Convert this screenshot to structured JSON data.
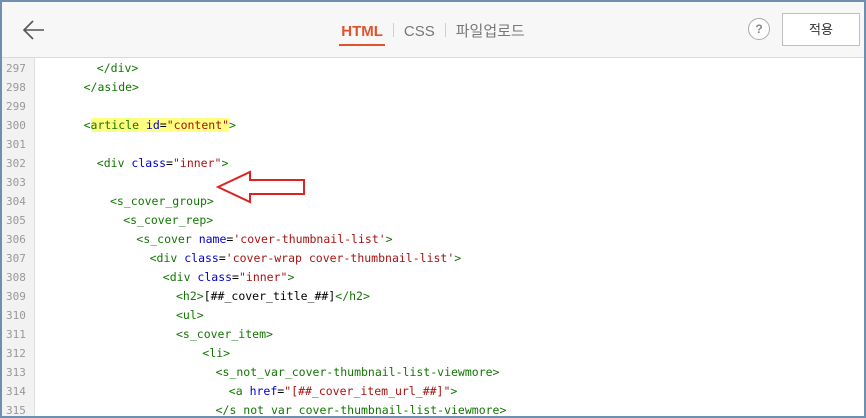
{
  "header": {
    "tabs": [
      {
        "label": "HTML",
        "active": true
      },
      {
        "label": "CSS",
        "active": false
      },
      {
        "label": "파일업로드",
        "active": false
      }
    ],
    "help_label": "?",
    "apply_label": "적용",
    "accent_color": "#e0532d"
  },
  "editor": {
    "lines": [
      {
        "n": "297",
        "indent": 8,
        "tokens": [
          [
            "tag",
            "</div>"
          ]
        ]
      },
      {
        "n": "298",
        "indent": 6,
        "tokens": [
          [
            "tag",
            "</aside>"
          ]
        ]
      },
      {
        "n": "299",
        "indent": 0,
        "tokens": []
      },
      {
        "n": "300",
        "indent": 6,
        "tokens": [
          [
            "tag",
            "<"
          ],
          [
            "tag hl",
            "article"
          ],
          [
            "txt hl",
            " "
          ],
          [
            "attr hl",
            "id"
          ],
          [
            "txt hl",
            "="
          ],
          [
            "str hl",
            "\"content\""
          ],
          [
            "tag",
            ">"
          ]
        ]
      },
      {
        "n": "301",
        "indent": 0,
        "tokens": []
      },
      {
        "n": "302",
        "indent": 8,
        "tokens": [
          [
            "tag",
            "<div "
          ],
          [
            "attr",
            "class"
          ],
          [
            "txt",
            "="
          ],
          [
            "str",
            "\"inner\""
          ],
          [
            "tag",
            ">"
          ]
        ]
      },
      {
        "n": "303",
        "indent": 0,
        "tokens": []
      },
      {
        "n": "304",
        "indent": 10,
        "tokens": [
          [
            "tag",
            "<s_cover_group>"
          ]
        ]
      },
      {
        "n": "305",
        "indent": 12,
        "tokens": [
          [
            "tag",
            "<s_cover_rep>"
          ]
        ]
      },
      {
        "n": "306",
        "indent": 14,
        "tokens": [
          [
            "tag",
            "<s_cover "
          ],
          [
            "attr",
            "name"
          ],
          [
            "txt",
            "="
          ],
          [
            "str",
            "'cover-thumbnail-list'"
          ],
          [
            "tag",
            ">"
          ]
        ]
      },
      {
        "n": "307",
        "indent": 16,
        "tokens": [
          [
            "tag",
            "<div "
          ],
          [
            "attr",
            "class"
          ],
          [
            "txt",
            "="
          ],
          [
            "str",
            "'cover-wrap cover-thumbnail-list'"
          ],
          [
            "tag",
            ">"
          ]
        ]
      },
      {
        "n": "308",
        "indent": 18,
        "tokens": [
          [
            "tag",
            "<div "
          ],
          [
            "attr",
            "class"
          ],
          [
            "txt",
            "="
          ],
          [
            "str",
            "\"inner\""
          ],
          [
            "tag",
            ">"
          ]
        ]
      },
      {
        "n": "309",
        "indent": 20,
        "tokens": [
          [
            "tag",
            "<h2>"
          ],
          [
            "txt",
            "[##_cover_title_##]"
          ],
          [
            "tag",
            "</h2>"
          ]
        ]
      },
      {
        "n": "310",
        "indent": 20,
        "tokens": [
          [
            "tag",
            "<ul>"
          ]
        ]
      },
      {
        "n": "311",
        "indent": 20,
        "tokens": [
          [
            "tag",
            "<s_cover_item>"
          ]
        ]
      },
      {
        "n": "312",
        "indent": 24,
        "tokens": [
          [
            "tag",
            "<li>"
          ]
        ]
      },
      {
        "n": "313",
        "indent": 26,
        "tokens": [
          [
            "tag",
            "<s_not_var_cover-thumbnail-list-viewmore>"
          ]
        ]
      },
      {
        "n": "314",
        "indent": 28,
        "tokens": [
          [
            "tag",
            "<a "
          ],
          [
            "attr",
            "href"
          ],
          [
            "txt",
            "="
          ],
          [
            "str",
            "\"[##_cover_item_url_##]\""
          ],
          [
            "tag",
            ">"
          ]
        ]
      },
      {
        "n": "315",
        "indent": 26,
        "tokens": [
          [
            "tag",
            "</s_not_var_cover-thumbnail-list-viewmore>"
          ]
        ]
      }
    ]
  }
}
